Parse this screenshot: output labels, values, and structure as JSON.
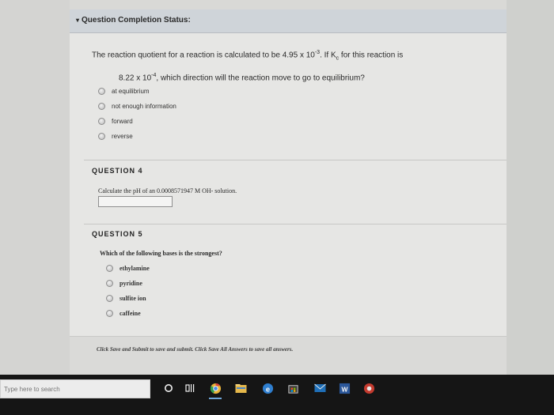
{
  "status": {
    "chevron": "▾",
    "title": "Question Completion Status:"
  },
  "q3": {
    "text_a": "The reaction quotient for a reaction is calculated to be 4.95 x 10",
    "exp_a": "-3",
    "text_b": ". If K",
    "sub_c": "c",
    "text_c": " for this reaction is",
    "text_d": "8.22 x 10",
    "exp_d": "-4",
    "text_e": ", which direction will the reaction move to go to equilibrium?",
    "options": [
      "at equilibrium",
      "not enough information",
      "forward",
      "reverse"
    ]
  },
  "q4": {
    "heading": "QUESTION 4",
    "text": "Calculate the pH of an 0.0008571947 M OH- solution.",
    "answer_value": ""
  },
  "q5": {
    "heading": "QUESTION 5",
    "text": "Which of the following bases is the strongest?",
    "options": [
      "ethylamine",
      "pyridine",
      "sulfite ion",
      "caffeine"
    ]
  },
  "footer": {
    "text": "Click Save and Submit to save and submit. Click Save All Answers to save all answers."
  },
  "taskbar": {
    "search_placeholder": "Type here to search",
    "icons": [
      "cortana-icon",
      "task-view-icon",
      "chrome-icon",
      "file-explorer-icon",
      "edge-icon",
      "store-icon",
      "mail-icon",
      "word-icon",
      "app-icon"
    ],
    "colors": {
      "taskbar": "#151515",
      "chrome": "#e8b43a",
      "edge": "#2f7fd0",
      "word": "#2b579a"
    }
  }
}
